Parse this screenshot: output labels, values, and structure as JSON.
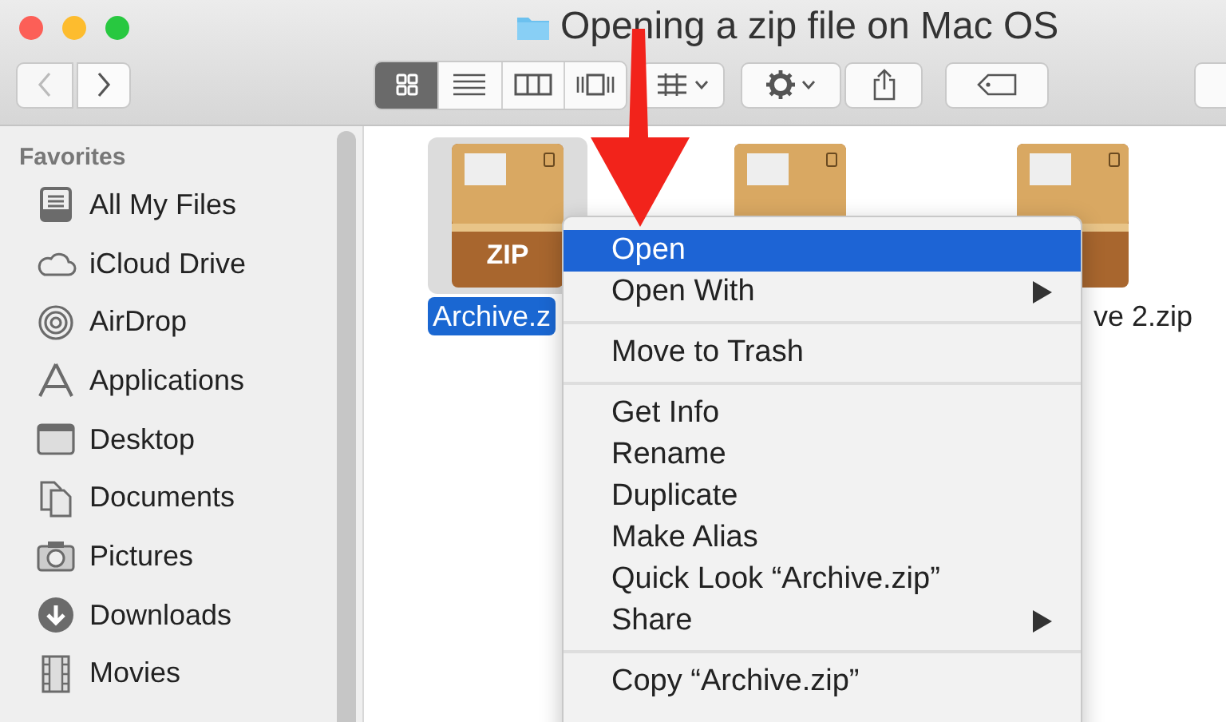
{
  "window": {
    "title": "Opening a zip file on Mac OS"
  },
  "toolbar": {
    "view_buttons": [
      {
        "kind": "icons",
        "selected": true
      },
      {
        "kind": "list",
        "selected": false
      },
      {
        "kind": "columns",
        "selected": false
      },
      {
        "kind": "coverflow",
        "selected": false
      }
    ]
  },
  "sidebar": {
    "heading": "Favorites",
    "items": [
      {
        "label": "All My Files",
        "kind": "files"
      },
      {
        "label": "iCloud Drive",
        "kind": "cloud"
      },
      {
        "label": "AirDrop",
        "kind": "airdrop"
      },
      {
        "label": "Applications",
        "kind": "apps"
      },
      {
        "label": "Desktop",
        "kind": "desktop"
      },
      {
        "label": "Documents",
        "kind": "documents"
      },
      {
        "label": "Pictures",
        "kind": "camera"
      },
      {
        "label": "Downloads",
        "kind": "download"
      },
      {
        "label": "Movies",
        "kind": "film"
      }
    ]
  },
  "files": [
    {
      "label": "Archive.z",
      "badge": "ZIP",
      "selected": true
    },
    {
      "selected": false
    },
    {
      "label": "ve 2.zip",
      "selected": false
    }
  ],
  "context_menu": {
    "items": [
      {
        "kind": "item",
        "label": "Open",
        "selected": true,
        "submenu": false
      },
      {
        "kind": "item",
        "label": "Open With",
        "selected": false,
        "submenu": true
      },
      {
        "kind": "separator"
      },
      {
        "kind": "item",
        "label": "Move to Trash",
        "selected": false,
        "submenu": false
      },
      {
        "kind": "separator"
      },
      {
        "kind": "item",
        "label": "Get Info",
        "selected": false,
        "submenu": false
      },
      {
        "kind": "item",
        "label": "Rename",
        "selected": false,
        "submenu": false
      },
      {
        "kind": "item",
        "label": "Duplicate",
        "selected": false,
        "submenu": false
      },
      {
        "kind": "item",
        "label": "Make Alias",
        "selected": false,
        "submenu": false
      },
      {
        "kind": "item",
        "label": "Quick Look “Archive.zip”",
        "selected": false,
        "submenu": false
      },
      {
        "kind": "item",
        "label": "Share",
        "selected": false,
        "submenu": true
      },
      {
        "kind": "separator"
      },
      {
        "kind": "item",
        "label": "Copy “Archive.zip”",
        "selected": false,
        "submenu": false
      }
    ]
  }
}
